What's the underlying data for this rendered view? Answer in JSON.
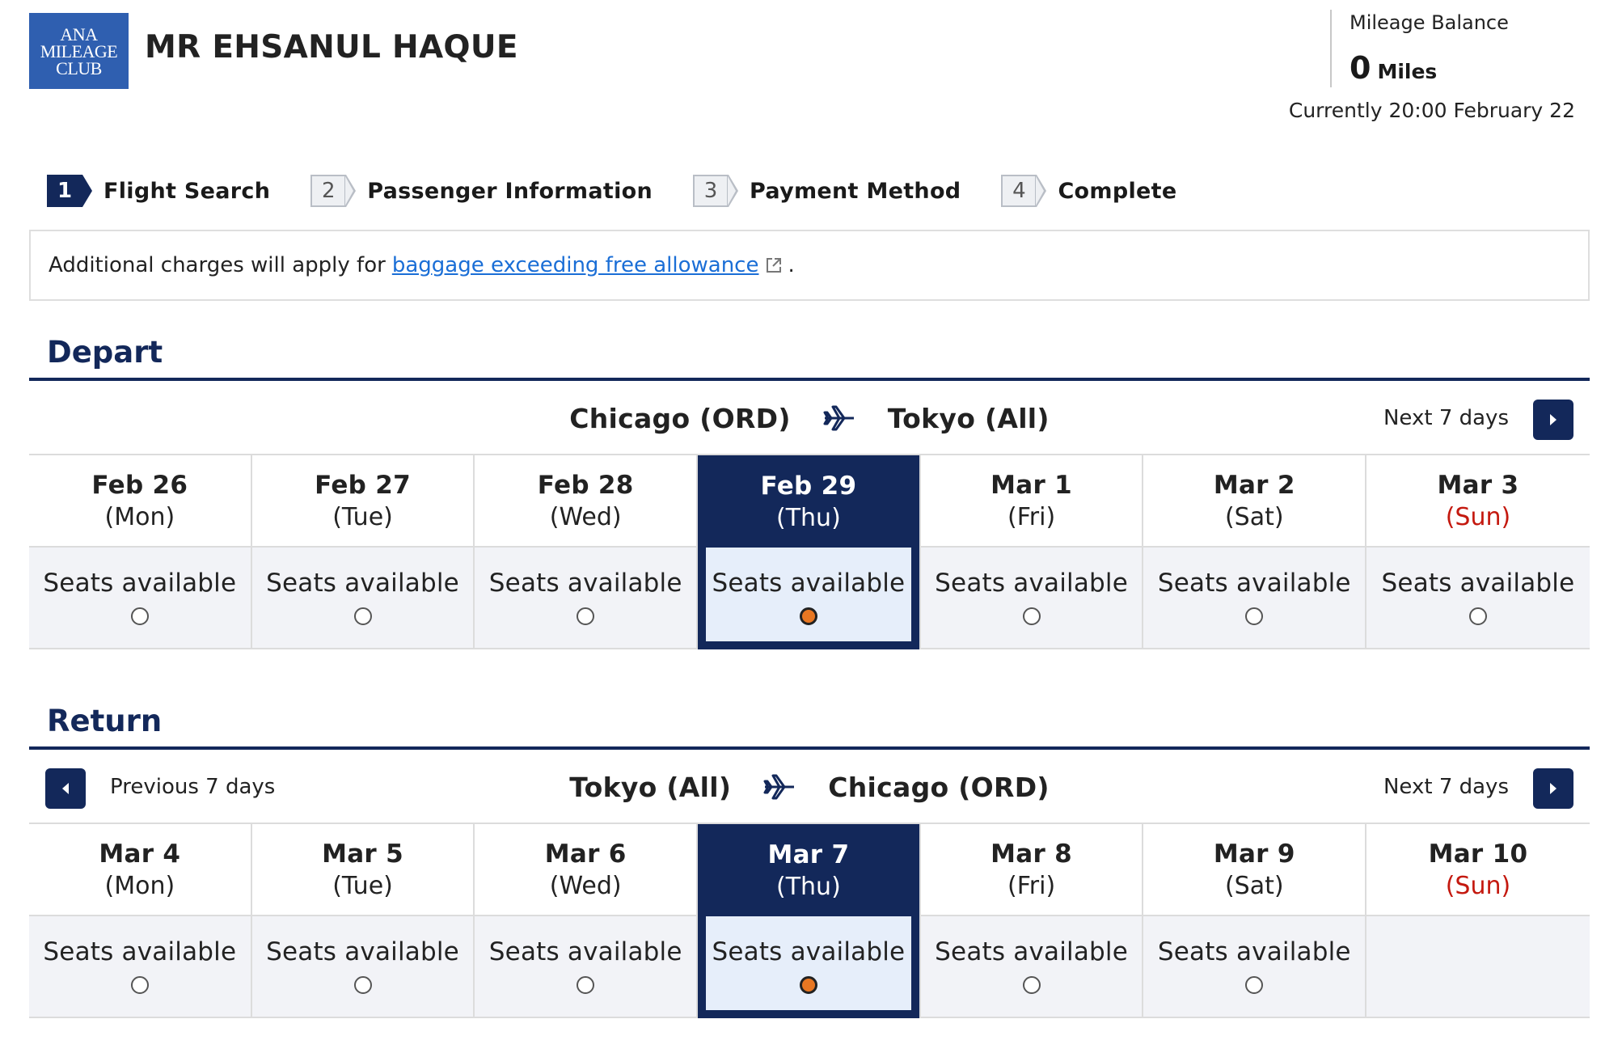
{
  "header": {
    "logo_lines": [
      "ANA",
      "MILEAGE",
      "CLUB"
    ],
    "member_name": "MR EHSANUL HAQUE",
    "mileage_label": "Mileage Balance",
    "mileage_value": "0",
    "mileage_unit": "Miles",
    "current_time": "Currently 20:00 February 22"
  },
  "steps": [
    {
      "num": "1",
      "label": "Flight Search",
      "active": true
    },
    {
      "num": "2",
      "label": "Passenger Information",
      "active": false
    },
    {
      "num": "3",
      "label": "Payment Method",
      "active": false
    },
    {
      "num": "4",
      "label": "Complete",
      "active": false
    }
  ],
  "notice": {
    "prefix": "Additional charges will apply for",
    "link": "baggage exceeding free allowance",
    "suffix": "."
  },
  "depart": {
    "title": "Depart",
    "from": "Chicago (ORD)",
    "to": "Tokyo (All)",
    "next_label": "Next 7 days",
    "days": [
      {
        "date": "Feb 26",
        "dow": "(Mon)",
        "status": "Seats available",
        "selected": false,
        "sun": false
      },
      {
        "date": "Feb 27",
        "dow": "(Tue)",
        "status": "Seats available",
        "selected": false,
        "sun": false
      },
      {
        "date": "Feb 28",
        "dow": "(Wed)",
        "status": "Seats available",
        "selected": false,
        "sun": false
      },
      {
        "date": "Feb 29",
        "dow": "(Thu)",
        "status": "Seats available",
        "selected": true,
        "sun": false
      },
      {
        "date": "Mar 1",
        "dow": "(Fri)",
        "status": "Seats available",
        "selected": false,
        "sun": false
      },
      {
        "date": "Mar 2",
        "dow": "(Sat)",
        "status": "Seats available",
        "selected": false,
        "sun": false
      },
      {
        "date": "Mar 3",
        "dow": "(Sun)",
        "status": "Seats available",
        "selected": false,
        "sun": true
      }
    ]
  },
  "return": {
    "title": "Return",
    "from": "Tokyo (All)",
    "to": "Chicago (ORD)",
    "prev_label": "Previous 7 days",
    "next_label": "Next 7 days",
    "days": [
      {
        "date": "Mar 4",
        "dow": "(Mon)",
        "status": "Seats available",
        "selected": false,
        "sun": false
      },
      {
        "date": "Mar 5",
        "dow": "(Tue)",
        "status": "Seats available",
        "selected": false,
        "sun": false
      },
      {
        "date": "Mar 6",
        "dow": "(Wed)",
        "status": "Seats available",
        "selected": false,
        "sun": false
      },
      {
        "date": "Mar 7",
        "dow": "(Thu)",
        "status": "Seats available",
        "selected": true,
        "sun": false
      },
      {
        "date": "Mar 8",
        "dow": "(Fri)",
        "status": "Seats available",
        "selected": false,
        "sun": false
      },
      {
        "date": "Mar 9",
        "dow": "(Sat)",
        "status": "Seats available",
        "selected": false,
        "sun": false
      },
      {
        "date": "Mar 10",
        "dow": "(Sun)",
        "status": "",
        "selected": false,
        "sun": true
      }
    ]
  },
  "colors": {
    "navy": "#13285a",
    "link": "#1a6ed6",
    "sunday": "#c4190f",
    "selected_radio": "#e87722",
    "logo_blue": "#2f5fb0"
  }
}
